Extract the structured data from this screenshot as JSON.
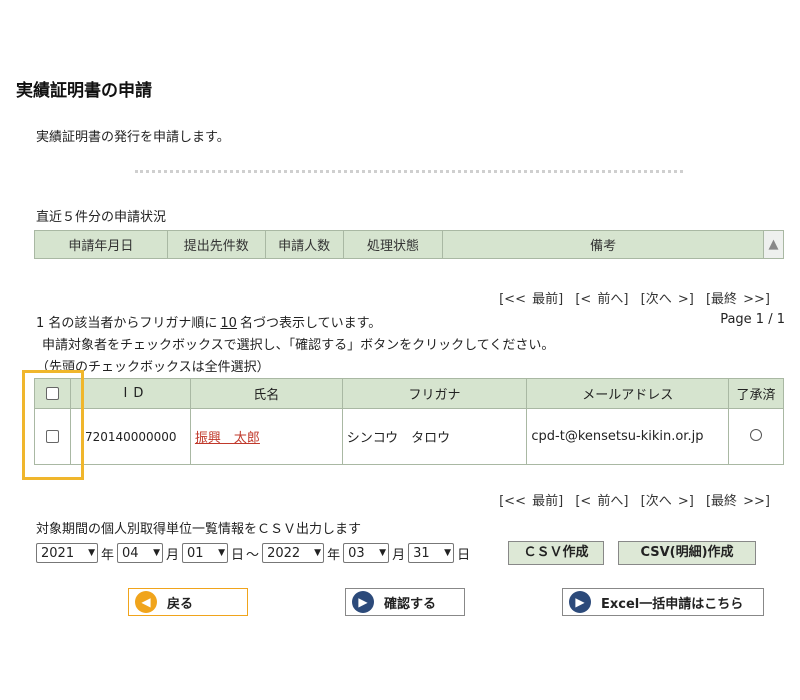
{
  "page": {
    "title": "実績証明書の申請",
    "intro": "実績証明書の発行を申請します。"
  },
  "recent": {
    "label": "直近５件分の申請状況",
    "columns": [
      "申請年月日",
      "提出先件数",
      "申請人数",
      "処理状態",
      "備考"
    ],
    "scroll_icon": "▲"
  },
  "pager": {
    "first": "[<< 最前]",
    "prev": "[< 前へ]",
    "next": "[次へ >]",
    "last": "[最終 >>]"
  },
  "summary": {
    "prefix": "1 名の該当者からフリガナ順に",
    "per_page": "10",
    "suffix": "名づつ表示しています。",
    "page_info": "Page 1 / 1",
    "instruction1": "申請対象者をチェックボックスで選択し、「確認する」ボタンをクリックしてください。",
    "instruction2": "（先頭のチェックボックスは全件選択）"
  },
  "results": {
    "columns": [
      "ID",
      "氏名",
      "フリガナ",
      "メールアドレス",
      "了承済"
    ],
    "rows": [
      {
        "id": "720140000000",
        "name": "振興　太郎",
        "furigana": "シンコウ　タロウ",
        "email": "cpd-t@kensetsu-kikin.or.jp"
      }
    ]
  },
  "csv": {
    "label": "対象期間の個人別取得単位一覧情報をＣＳＶ出力します",
    "from_year": "2021",
    "from_month": "04",
    "from_day": "01",
    "to_year": "2022",
    "to_month": "03",
    "to_day": "31",
    "year_unit": "年",
    "month_unit": "月",
    "day_unit": "日",
    "separator": "～",
    "csv_button": "ＣＳＶ作成",
    "csv_detail_button": "CSV(明細)作成"
  },
  "actions": {
    "back": "戻る",
    "confirm": "確認する",
    "excel": "Excel一括申請はこちら"
  },
  "colors": {
    "header_bg": "#d6e4cf",
    "highlight": "#f0b62c",
    "back_icon": "#f0a41c",
    "nav_icon": "#2c4a7a",
    "name_link": "#c0392b"
  }
}
